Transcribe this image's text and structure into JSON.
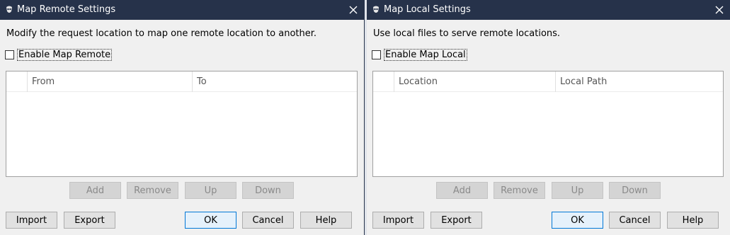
{
  "remote": {
    "title": "Map Remote Settings",
    "description": "Modify the request location to map one remote location to another.",
    "enable_label": "Enable Map Remote",
    "columns": [
      "",
      "From",
      "To"
    ],
    "buttons": {
      "add": "Add",
      "remove": "Remove",
      "up": "Up",
      "down": "Down",
      "import": "Import",
      "export": "Export",
      "ok": "OK",
      "cancel": "Cancel",
      "help": "Help"
    }
  },
  "local": {
    "title": "Map Local Settings",
    "description": "Use local files to serve remote locations.",
    "enable_label": "Enable Map Local",
    "columns": [
      "",
      "Location",
      "Local Path"
    ],
    "buttons": {
      "add": "Add",
      "remove": "Remove",
      "up": "Up",
      "down": "Down",
      "import": "Import",
      "export": "Export",
      "ok": "OK",
      "cancel": "Cancel",
      "help": "Help"
    }
  },
  "colors": {
    "titlebar": "#26324a",
    "background": "#f0f0f0",
    "default_button_border": "#0078d7"
  },
  "icons": {
    "app": "charles-app-icon",
    "close": "close-icon"
  }
}
